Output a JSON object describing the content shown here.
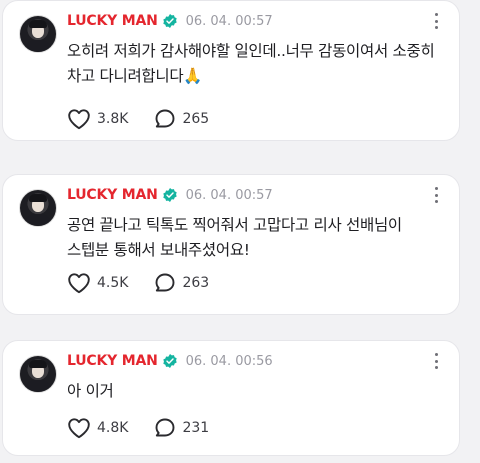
{
  "posts": [
    {
      "author": "LUCKY MAN",
      "timestamp": "06. 04. 00:57",
      "text_line1": "오히려 저희가 감사해야할 일인데..너무 감동이여서 소중히",
      "text_line2": "차고 다니려합니다🙏",
      "likes": "3.8K",
      "comments": "265"
    },
    {
      "author": "LUCKY MAN",
      "timestamp": "06. 04. 00:57",
      "text_line1": "공연 끝나고 틱톡도 찍어줘서 고맙다고 리사 선배님이",
      "text_line2": "스텝분 통해서 보내주셨어요!",
      "likes": "4.5K",
      "comments": "263"
    },
    {
      "author": "LUCKY MAN",
      "timestamp": "06. 04. 00:56",
      "text_line1": "아 이거",
      "text_line2": "",
      "likes": "4.8K",
      "comments": "231"
    }
  ],
  "icons": {
    "verified": "verified-badge-icon",
    "like": "heart-icon",
    "comment": "comment-bubble-icon",
    "more": "more-vertical-icon"
  },
  "colors": {
    "author_name": "#e4262e",
    "verified_badge": "#14b4a0",
    "timestamp": "#9a9aa2",
    "page_background": "#f2f2f4",
    "card_background": "#ffffff"
  }
}
